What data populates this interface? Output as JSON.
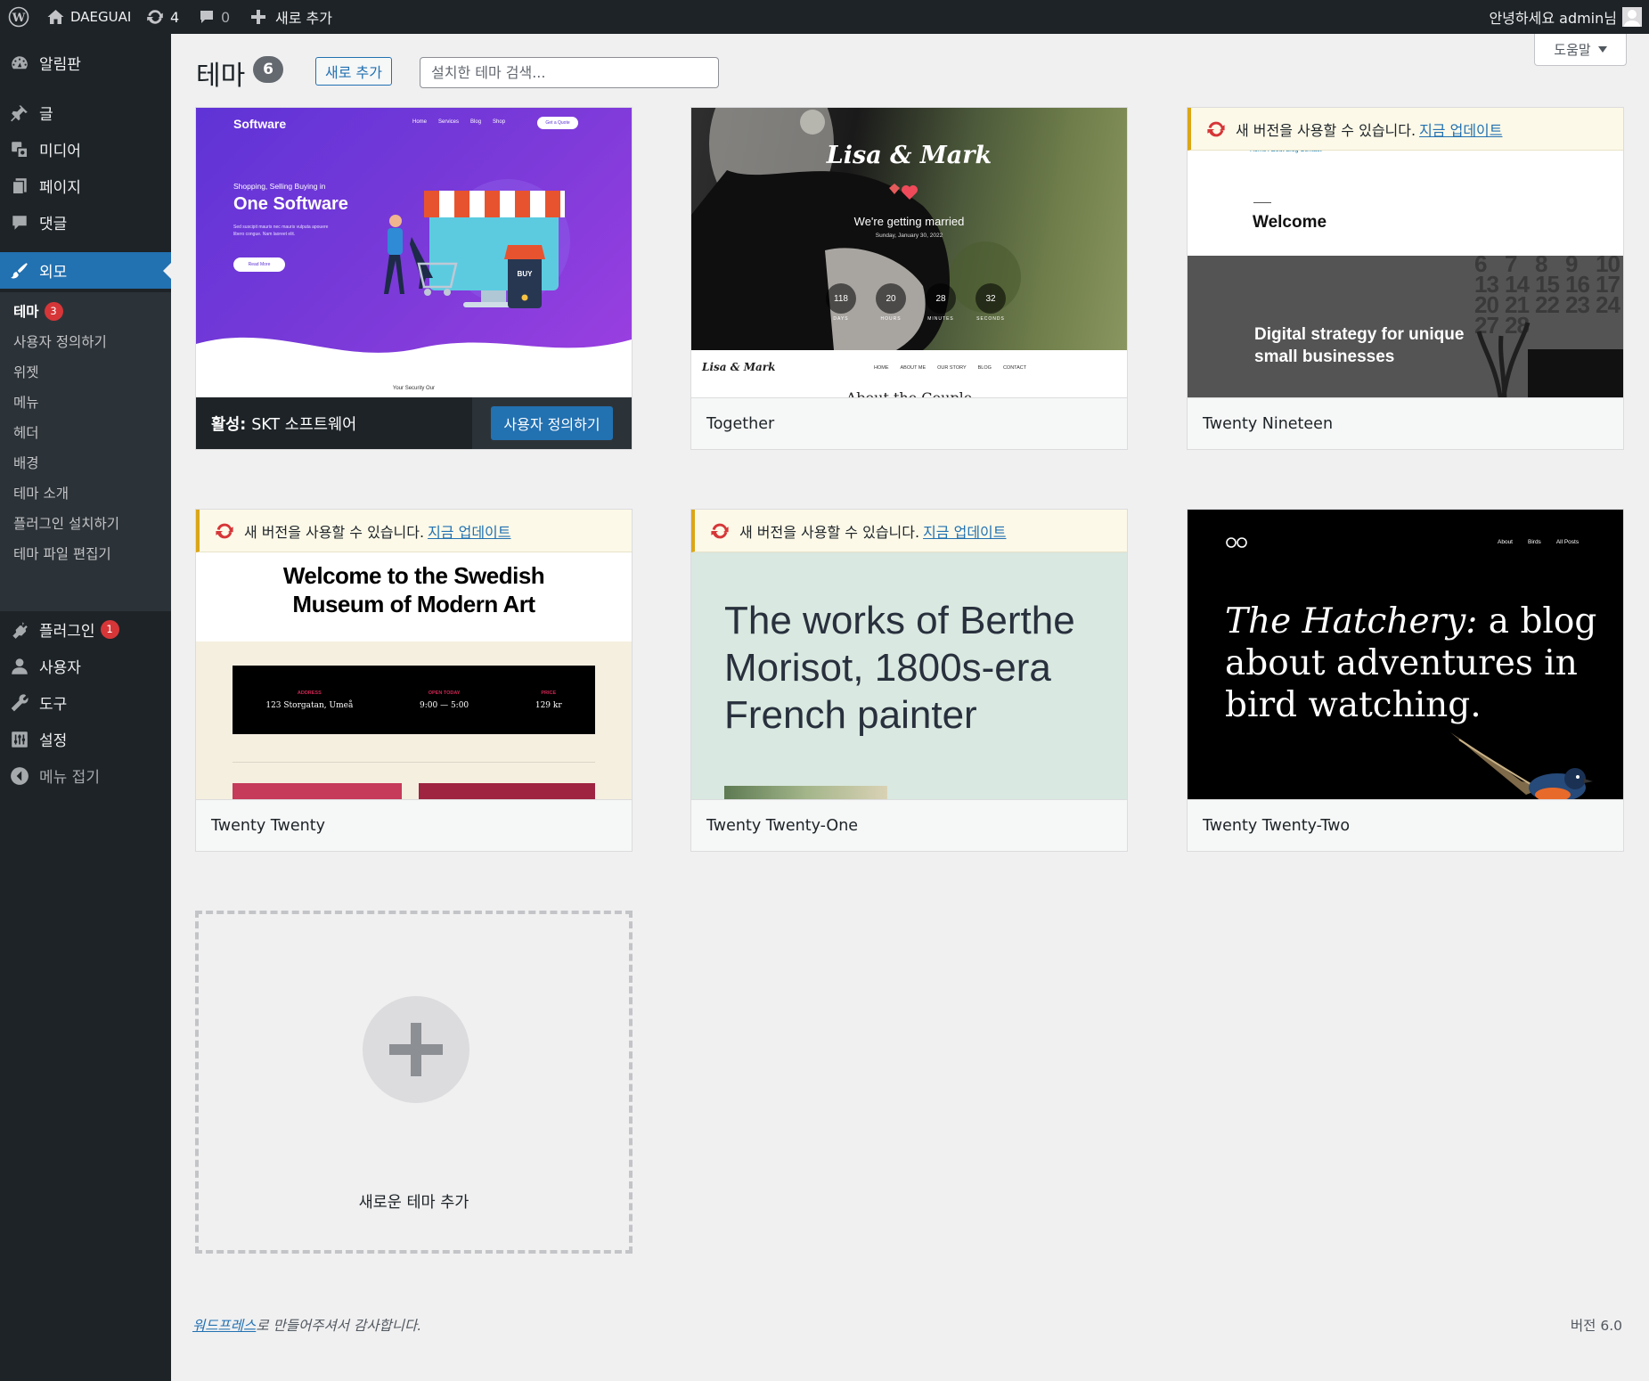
{
  "adminbar": {
    "site_name": "DAEGUAI",
    "updates_count": "4",
    "comments_count": "0",
    "new_label": "새로 추가",
    "greeting": "안녕하세요 admin님"
  },
  "sidebar": {
    "items": [
      {
        "label": "알림판",
        "icon": "dashboard-icon"
      },
      {
        "label": "글",
        "icon": "pin-icon"
      },
      {
        "label": "미디어",
        "icon": "media-icon"
      },
      {
        "label": "페이지",
        "icon": "page-icon"
      },
      {
        "label": "댓글",
        "icon": "comment-icon"
      },
      {
        "label": "외모",
        "icon": "brush-icon"
      },
      {
        "label": "플러그인",
        "icon": "plugin-icon",
        "badge": "1"
      },
      {
        "label": "사용자",
        "icon": "user-icon"
      },
      {
        "label": "도구",
        "icon": "wrench-icon"
      },
      {
        "label": "설정",
        "icon": "settings-icon"
      }
    ],
    "submenu": [
      {
        "label": "테마",
        "badge": "3"
      },
      {
        "label": "사용자 정의하기"
      },
      {
        "label": "위젯"
      },
      {
        "label": "메뉴"
      },
      {
        "label": "헤더"
      },
      {
        "label": "배경"
      },
      {
        "label": "테마 소개"
      },
      {
        "label": "플러그인 설치하기"
      },
      {
        "label": "테마 파일 편집기"
      }
    ],
    "collapse_label": "메뉴 접기"
  },
  "header": {
    "title": "테마",
    "count": "6",
    "add_new_label": "새로 추가",
    "search_placeholder": "설치한 테마 검색...",
    "help_label": "도움말"
  },
  "update_notice": {
    "text": "새 버전을 사용할 수 있습니다.",
    "link": "지금 업데이트"
  },
  "themes": [
    {
      "name": "SKT 소프트웨어",
      "active_prefix": "활성:",
      "customize_label": "사용자 정의하기",
      "shot": {
        "brand": "Software",
        "nav": [
          "Home",
          "Services",
          "Blog",
          "Shop"
        ],
        "cta": "Get a Quote",
        "kicker": "Shopping, Selling Buying in",
        "headline": "One Software",
        "body": "Sed suscipit mauris nec mauris vulputa apouere libero congue. Nam laoreet elit.",
        "button": "Read More",
        "buy": "BUY",
        "below": "Your Security Our"
      }
    },
    {
      "name": "Together",
      "shot": {
        "couple": "Lisa & Mark",
        "subtitle": "We're getting married",
        "date": "Sunday, January 30, 2022",
        "countdown": [
          {
            "v": "118",
            "l": "DAYS"
          },
          {
            "v": "20",
            "l": "HOURS"
          },
          {
            "v": "28",
            "l": "MINUTES"
          },
          {
            "v": "32",
            "l": "SECONDS"
          }
        ],
        "nav": [
          "HOME",
          "ABOUT ME",
          "OUR STORY",
          "BLOG",
          "CONTACT"
        ],
        "below": "About the Couple"
      }
    },
    {
      "name": "Twenty Nineteen",
      "update": true,
      "shot": {
        "nav": "Home About Blog Contact",
        "welcome": "Welcome",
        "hero": "Digital strategy for unique small businesses",
        "calendar": [
          "6",
          "7",
          "8",
          "9",
          "10",
          "13",
          "14",
          "15",
          "16",
          "17",
          "20",
          "21",
          "22",
          "23",
          "24",
          "27",
          "28"
        ]
      }
    },
    {
      "name": "Twenty Twenty",
      "update": true,
      "shot": {
        "headline": "Welcome to the Swedish Museum of Modern Art",
        "cols": [
          {
            "label": "ADDRESS",
            "value": "123 Storgatan, Umeå"
          },
          {
            "label": "OPEN TODAY",
            "value": "9:00 — 5:00"
          },
          {
            "label": "PRICE",
            "value": "129 kr"
          }
        ]
      }
    },
    {
      "name": "Twenty Twenty-One",
      "update": true,
      "shot": {
        "headline": "The works of Berthe Morisot, 1800s-era French painter"
      }
    },
    {
      "name": "Twenty Twenty-Two",
      "shot": {
        "nav": [
          "About",
          "Birds",
          "All Posts"
        ],
        "headline_em": "The Hatchery:",
        "headline_rest": " a blog about adventures in bird watching."
      }
    }
  ],
  "add_theme_label": "새로운 테마 추가",
  "footer": {
    "link": "워드프레스",
    "thanks": "로 만들어주셔서 감사합니다.",
    "version": "버전 6.0"
  },
  "colors": {
    "admin_bar": "#1d2327",
    "accent": "#2271b1",
    "badge": "#d63638",
    "notice_border": "#dba617",
    "update_icon": "#d63638"
  }
}
